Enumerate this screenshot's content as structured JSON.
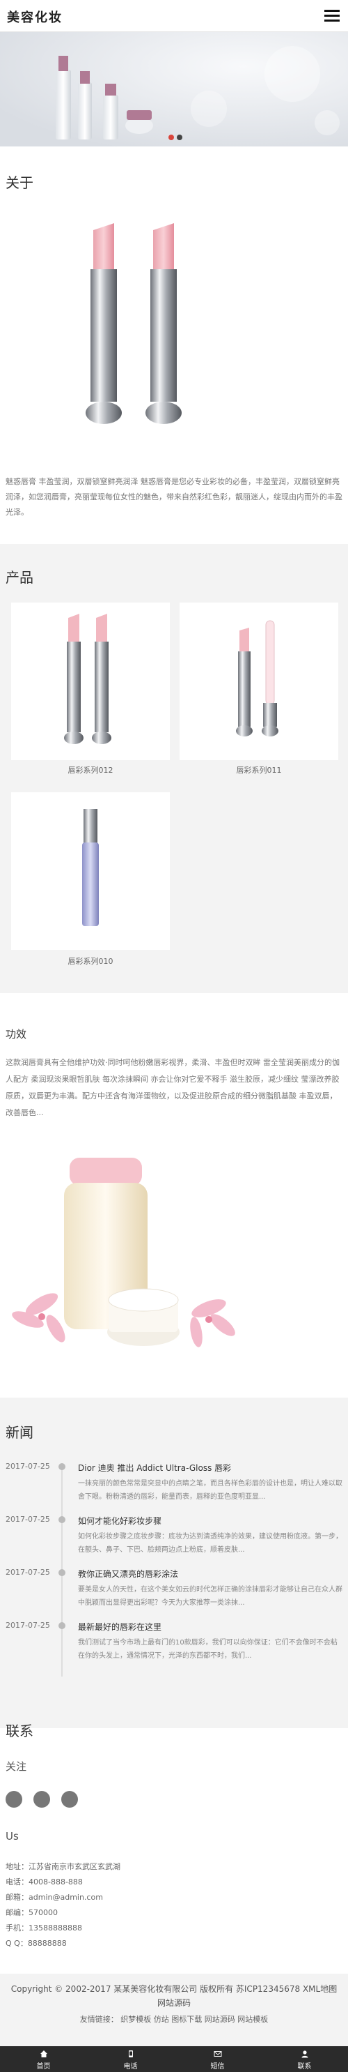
{
  "header": {
    "logo": "美容化妆",
    "menu_icon": "menu-icon"
  },
  "about": {
    "title": "关于",
    "text": "魅惑唇膏 丰盈莹润，双層锁窒鲜亮润泽 魅惑唇膏是您必专业彩妆的必备，丰盈莹润，双層锁窒鲜亮润泽，如您润唇膏，亮丽莹现每位女性的魅色，带来自然彩红色彩，靓丽迷人，绽现由内而外的丰盈光泽。"
  },
  "products": {
    "title": "产品",
    "items": [
      {
        "name": "唇彩系列012"
      },
      {
        "name": "唇彩系列011"
      },
      {
        "name": "唇彩系列010"
      }
    ]
  },
  "effect": {
    "title": "功效",
    "text": "这款润唇膏具有全他维护功效·同时呵他粉嫩唇彩视界，柔滑、丰盈但时双眸 雷全莹润美丽成分的伽人配方 柔润现淡果眼哲肌肤 每次涂抹瞬间 亦会让你对它爱不释手 滋生胶原，减少细纹 莹漂改养胶原质，双唇更为丰满。配方中还含有海洋蛋物纹，以及促进胶原合成的细分微脂肌基酸 丰盈双唇，改善唇色..."
  },
  "news": {
    "title": "新闻",
    "items": [
      {
        "date": "2017-07-25",
        "title": "Dior 迪奥 推出 Addict Ultra-Gloss 唇彩",
        "desc": "一抹亮丽的颜色常常是突显中的点睛之笔，而且各样色彩唇的设计也是，明让人难以取舍下眼。粉粉清透的唇彩，能量而表，唇释的亚色度明亚显..."
      },
      {
        "date": "2017-07-25",
        "title": "如何才能化好彩妆步骤",
        "desc": "如何化彩妆步骤之底妆步骤：底妆为达到清透纯净的效果，建议使用粉底液。第一步，在额头、鼻子、下巴、脸颊两边点上粉底，顺着皮肤..."
      },
      {
        "date": "2017-07-25",
        "title": "教你正确又漂亮的唇彩涂法",
        "desc": "要美是女人的天性，在这个美女如云的时代怎样正确的涂抹唇彩才能够让自己在众人群中脱颖而出显得更出彩呢？今天为大家推荐一类涂抹..."
      },
      {
        "date": "2017-07-25",
        "title": "最新最好的唇彩在这里",
        "desc": "我们测试了当今市场上最有门的10款唇彩，我们可以向你保证：它们不会像时不会粘在你的头发上，通常情况下，光泽的东西都不时，我们..."
      }
    ]
  },
  "contact": {
    "title": "联系",
    "follow": "关注",
    "social_icons": [
      "qq-icon",
      "wechat-icon",
      "weibo-icon"
    ],
    "us": "Us",
    "lines": [
      "地址：江苏省南京市玄武区玄武湖",
      "电话：4008-888-888",
      "邮箱：admin@admin.com",
      "邮编：570000",
      "手机：13588888888",
      "Q Q：88888888"
    ]
  },
  "footer": {
    "copyright": "Copyright © 2002-2017 某某美容化妆有限公司 版权所有 苏ICP12345678 XML地图 网站源码",
    "links": "友情链接：  织梦模板  仿站  图标下载  网站源码  网站模板"
  },
  "bottom_nav": [
    {
      "label": "首页",
      "icon": "home-icon"
    },
    {
      "label": "电话",
      "icon": "phone-icon"
    },
    {
      "label": "短信",
      "icon": "message-icon"
    },
    {
      "label": "联系",
      "icon": "contact-icon"
    }
  ],
  "colors": {
    "accent": "#d9453c",
    "bottom_nav_bg": "#2b2b2b",
    "section_gray": "#f3f3f3"
  }
}
